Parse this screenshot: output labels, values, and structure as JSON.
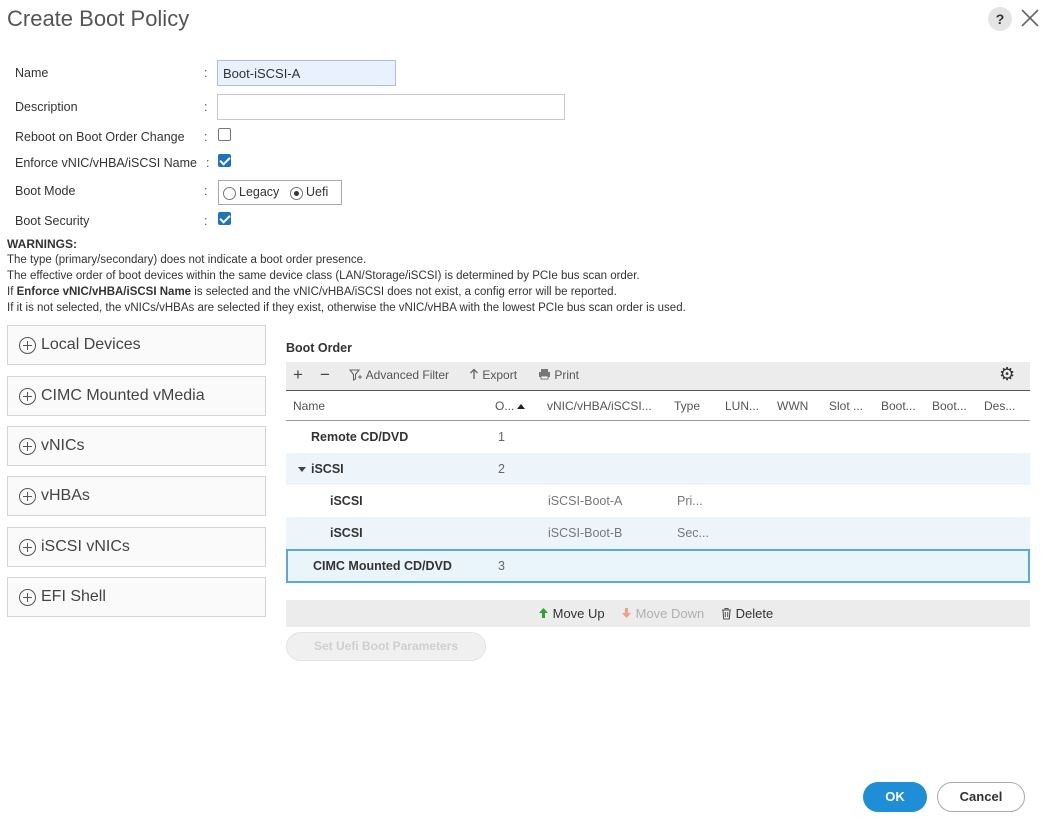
{
  "dialog": {
    "title": "Create Boot Policy",
    "help_label": "?",
    "close_icon": "close-icon"
  },
  "form": {
    "name_label": "Name",
    "name_value": "Boot-iSCSI-A",
    "description_label": "Description",
    "description_value": "",
    "reboot_label": "Reboot on Boot Order Change",
    "reboot_checked": false,
    "enforce_label": "Enforce vNIC/vHBA/iSCSI Name",
    "enforce_checked": true,
    "boot_mode_label": "Boot Mode",
    "boot_mode_options": [
      "Legacy",
      "Uefi"
    ],
    "boot_mode_selected": "Uefi",
    "boot_security_label": "Boot Security",
    "boot_security_checked": true,
    "colon": ":"
  },
  "warnings": {
    "title": "WARNINGS:",
    "line1": "The type (primary/secondary) does not indicate a boot order presence.",
    "line2": "The effective order of boot devices within the same device class (LAN/Storage/iSCSI) is determined by PCIe bus scan order.",
    "line3_prefix": "If ",
    "line3_bold": "Enforce vNIC/vHBA/iSCSI Name",
    "line3_suffix": " is selected and the vNIC/vHBA/iSCSI does not exist, a config error will be reported.",
    "line4": "If it is not selected, the vNICs/vHBAs are selected if they exist, otherwise the vNIC/vHBA with the lowest PCIe bus scan order is used."
  },
  "device_sections": [
    {
      "label": "Local Devices"
    },
    {
      "label": "CIMC Mounted vMedia"
    },
    {
      "label": "vNICs"
    },
    {
      "label": "vHBAs"
    },
    {
      "label": "iSCSI vNICs"
    },
    {
      "label": "EFI Shell"
    }
  ],
  "boot_order": {
    "title": "Boot Order",
    "toolbar": {
      "add": "+",
      "remove": "−",
      "advanced_filter": "Advanced Filter",
      "export": "Export",
      "print": "Print"
    },
    "columns": [
      "Name",
      "O...",
      "vNIC/vHBA/iSCSI...",
      "Type",
      "LUN...",
      "WWN",
      "Slot ...",
      "Boot...",
      "Boot...",
      "Des..."
    ],
    "rows": [
      {
        "name": "Remote CD/DVD",
        "order": "1",
        "vnic": "",
        "type": ""
      },
      {
        "name": "iSCSI",
        "order": "2",
        "vnic": "",
        "type": ""
      },
      {
        "name": "iSCSI",
        "order": "",
        "vnic": "iSCSI-Boot-A",
        "type": "Pri..."
      },
      {
        "name": "iSCSI",
        "order": "",
        "vnic": "iSCSI-Boot-B",
        "type": "Sec..."
      },
      {
        "name": "CIMC Mounted CD/DVD",
        "order": "3",
        "vnic": "",
        "type": ""
      }
    ],
    "actions": {
      "move_up": "Move Up",
      "move_down": "Move Down",
      "delete": "Delete"
    },
    "set_uefi_label": "Set Uefi Boot Parameters"
  },
  "footer": {
    "ok_label": "OK",
    "cancel_label": "Cancel"
  },
  "colors": {
    "accent": "#1e8fd6",
    "checkbox": "#1e73be",
    "selected_row_border": "#5aa9dc",
    "move_up_arrow": "#2ea12e",
    "move_down_arrow": "#f0a08a"
  }
}
